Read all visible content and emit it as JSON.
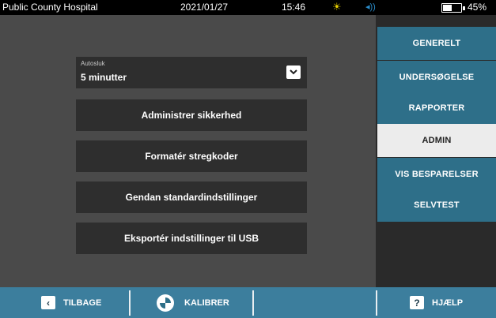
{
  "status": {
    "hospital": "Public County Hospital",
    "date": "2021/01/27",
    "time": "15:46",
    "sun_icon": "☀",
    "speaker_icon": "◂))",
    "battery_level": 0.45,
    "battery_percent": "45%"
  },
  "main": {
    "autosluk_label": "Autosluk",
    "autosluk_value": "5 minutter",
    "buttons": [
      "Administrer sikkerhed",
      "Formatér stregkoder",
      "Gendan standardindstillinger",
      "Eksportér indstillinger til USB"
    ]
  },
  "menu": {
    "items": [
      "GENERELT",
      "UNDERSØGELSE",
      "RAPPORTER",
      "ADMIN",
      "VIS BESPARELSER",
      "SELVTEST"
    ],
    "active": "ADMIN",
    "accent": "#2e6f89"
  },
  "bottom": {
    "back_label": "TILBAGE",
    "back_icon": "‹",
    "calibrate_label": "KALIBRER",
    "help_label": "HJÆLP",
    "help_icon": "?",
    "bar_color": "#3c7e9d"
  }
}
